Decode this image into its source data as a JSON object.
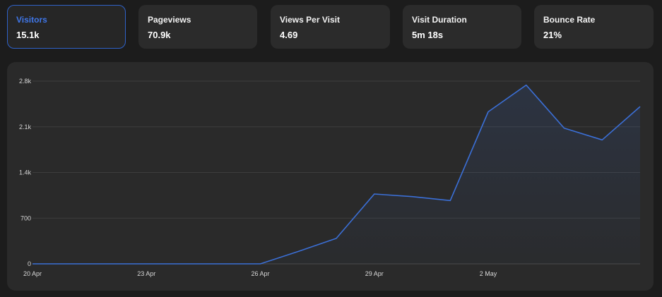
{
  "metrics": [
    {
      "label": "Visitors",
      "value": "15.1k",
      "selected": true
    },
    {
      "label": "Pageviews",
      "value": "70.9k",
      "selected": false
    },
    {
      "label": "Views Per Visit",
      "value": "4.69",
      "selected": false
    },
    {
      "label": "Visit Duration",
      "value": "5m 18s",
      "selected": false
    },
    {
      "label": "Bounce Rate",
      "value": "21%",
      "selected": false
    }
  ],
  "colors": {
    "accent": "#2f62c9",
    "line": "#3b6fd6",
    "background": "#1c1c1c",
    "card": "#2b2b2b",
    "panel": "#2a2a2a"
  },
  "chart_data": {
    "type": "area",
    "series": [
      {
        "values": [
          0,
          0,
          0,
          0,
          0,
          0,
          0,
          190,
          390,
          1070,
          1030,
          970,
          2330,
          2740,
          2080,
          1900,
          2410
        ]
      }
    ],
    "x": [
      "20 Apr",
      "21 Apr",
      "22 Apr",
      "23 Apr",
      "24 Apr",
      "25 Apr",
      "26 Apr",
      "27 Apr",
      "28 Apr",
      "29 Apr",
      "30 Apr",
      "1 May",
      "2 May",
      "3 May",
      "4 May",
      "5 May",
      "6 May"
    ],
    "x_tick_labels": [
      "20 Apr",
      "23 Apr",
      "26 Apr",
      "29 Apr",
      "2 May"
    ],
    "y_tick_labels": [
      "0",
      "700",
      "1.4k",
      "2.1k",
      "2.8k"
    ],
    "ylim": [
      0,
      2800
    ],
    "grid": true,
    "legend": "none"
  }
}
